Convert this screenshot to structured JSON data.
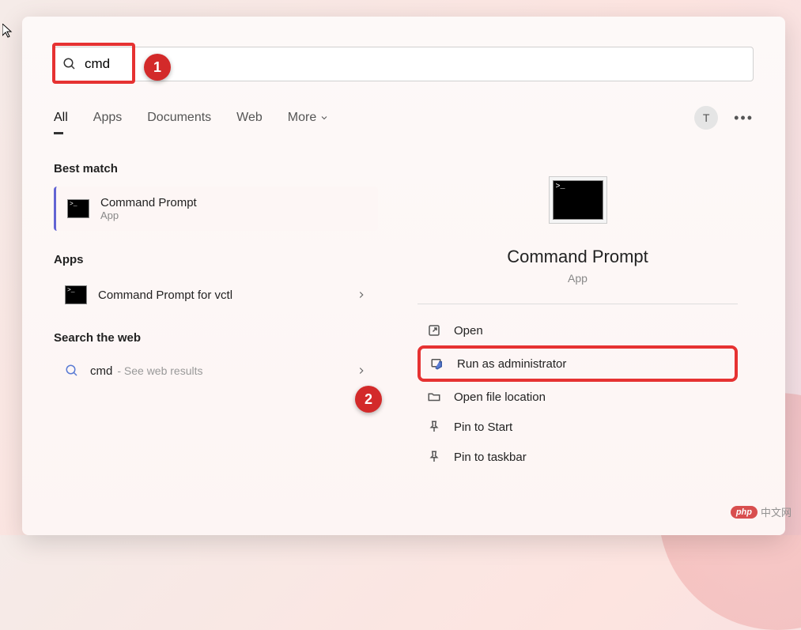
{
  "search": {
    "query": "cmd"
  },
  "tabs": {
    "all": "All",
    "apps": "Apps",
    "documents": "Documents",
    "web": "Web",
    "more": "More"
  },
  "user": {
    "initial": "T"
  },
  "left": {
    "best_match_head": "Best match",
    "best_match": {
      "title": "Command Prompt",
      "subtitle": "App"
    },
    "apps_head": "Apps",
    "app_item": "Command Prompt for vctl",
    "web_head": "Search the web",
    "web_query": "cmd",
    "web_hint": "- See web results"
  },
  "preview": {
    "title": "Command Prompt",
    "subtitle": "App",
    "actions": {
      "open": "Open",
      "run_admin": "Run as administrator",
      "open_loc": "Open file location",
      "pin_start": "Pin to Start",
      "pin_taskbar": "Pin to taskbar"
    }
  },
  "callouts": {
    "one": "1",
    "two": "2"
  },
  "watermark": {
    "badge": "php",
    "text": "中文网"
  }
}
